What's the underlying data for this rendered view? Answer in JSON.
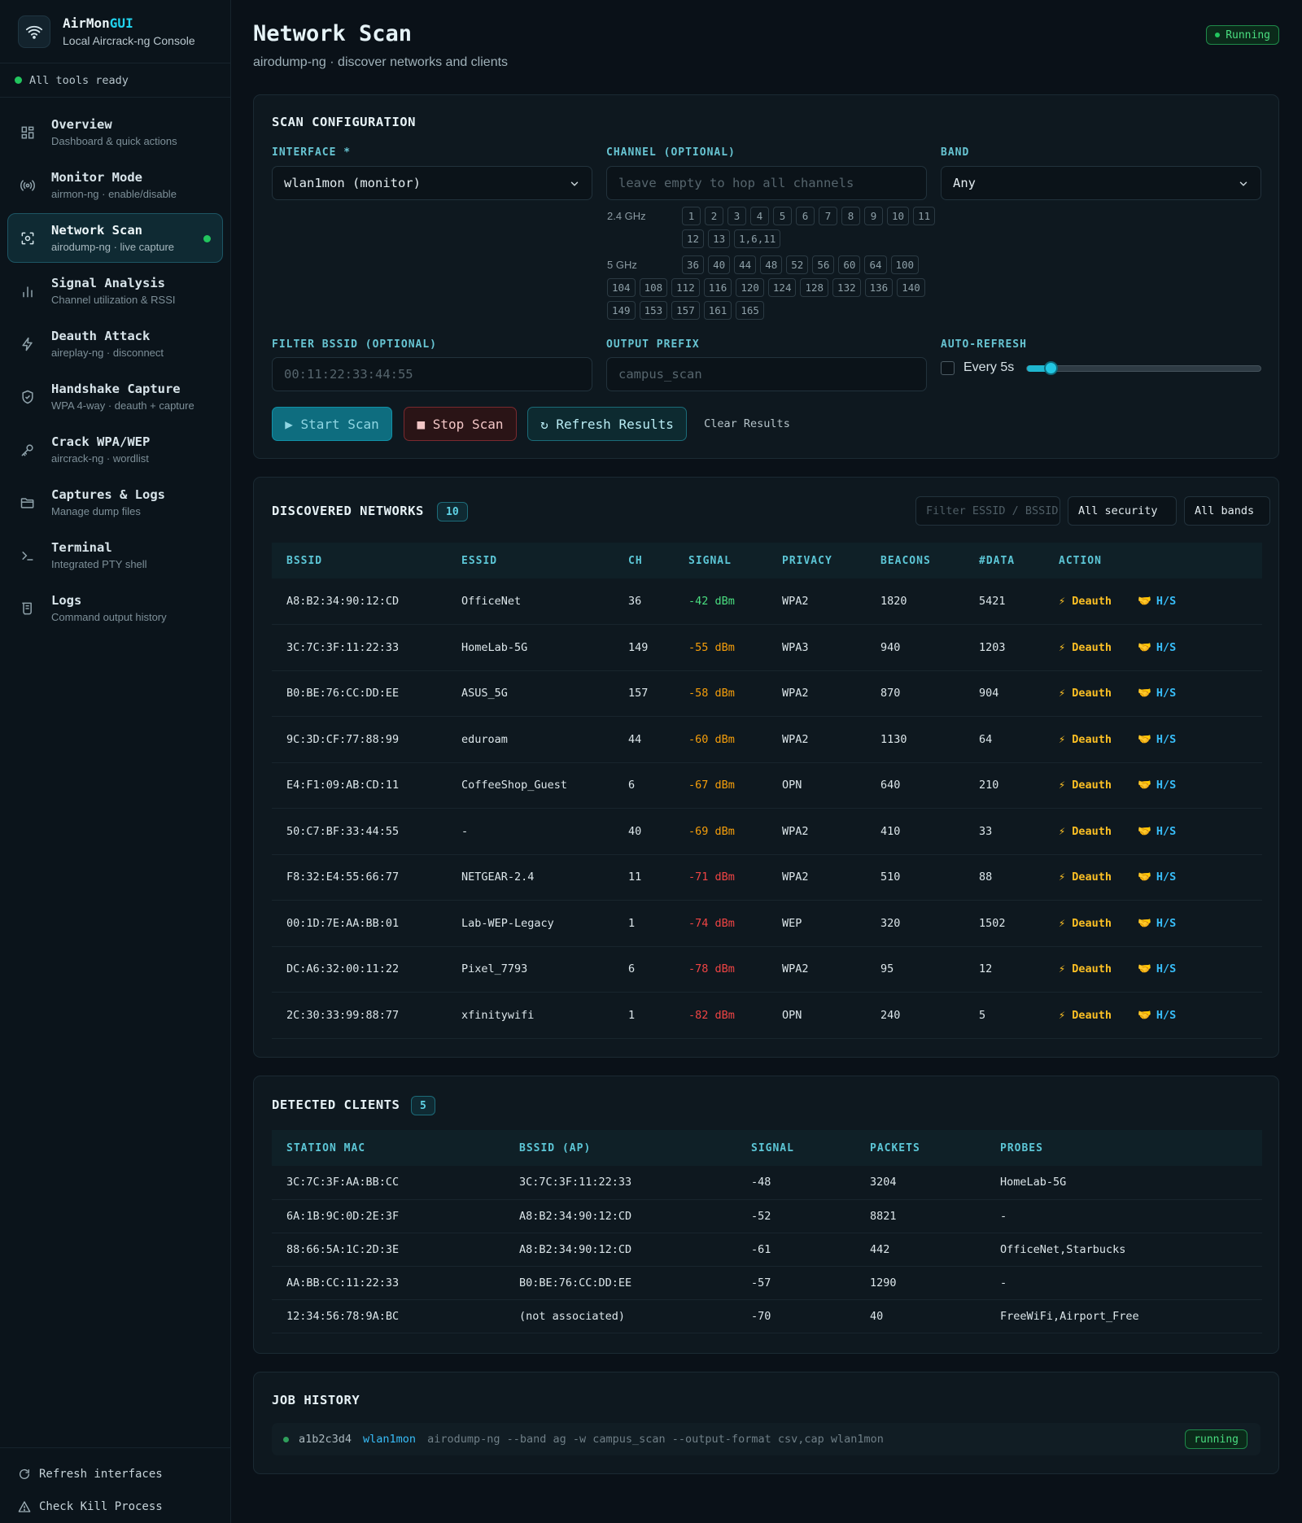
{
  "app": {
    "title_prefix": "AirMon",
    "title_accent": "GUI",
    "subtitle": "Local Aircrack-ng Console",
    "status": "All tools ready"
  },
  "sidebar": {
    "items": [
      {
        "label": "Overview",
        "sub": "Dashboard & quick actions",
        "icon": "grid-icon"
      },
      {
        "label": "Monitor Mode",
        "sub": "airmon-ng · enable/disable",
        "icon": "broadcast-icon"
      },
      {
        "label": "Network Scan",
        "sub": "airodump-ng · live capture",
        "icon": "scan-icon"
      },
      {
        "label": "Signal Analysis",
        "sub": "Channel utilization & RSSI",
        "icon": "bar-chart-icon"
      },
      {
        "label": "Deauth Attack",
        "sub": "aireplay-ng · disconnect",
        "icon": "bolt-icon"
      },
      {
        "label": "Handshake Capture",
        "sub": "WPA 4-way · deauth + capture",
        "icon": "shield-icon"
      },
      {
        "label": "Crack WPA/WEP",
        "sub": "aircrack-ng · wordlist",
        "icon": "key-icon"
      },
      {
        "label": "Captures & Logs",
        "sub": "Manage dump files",
        "icon": "folder-icon"
      },
      {
        "label": "Terminal",
        "sub": "Integrated PTY shell",
        "icon": "terminal-icon"
      },
      {
        "label": "Logs",
        "sub": "Command output history",
        "icon": "scroll-icon"
      }
    ],
    "refresh_interfaces": "Refresh interfaces",
    "check_kill": "Check Kill Process"
  },
  "header": {
    "title": "Network Scan",
    "subtitle": "airodump-ng · discover networks and clients",
    "status_badge": "Running"
  },
  "config": {
    "title": "SCAN CONFIGURATION",
    "interface_label": "INTERFACE *",
    "interface_value": "wlan1mon (monitor)",
    "channel_label": "CHANNEL (OPTIONAL)",
    "channel_placeholder": "leave empty to hop all channels",
    "band_label": "BAND",
    "band_value": "Any",
    "band_24_label": "2.4 GHz",
    "channels_24": [
      "1",
      "2",
      "3",
      "4",
      "5",
      "6",
      "7",
      "8",
      "9",
      "10",
      "11",
      "12",
      "13",
      "1,6,11"
    ],
    "band_5_label": "5 GHz",
    "channels_5": [
      "36",
      "40",
      "44",
      "48",
      "52",
      "56",
      "60",
      "64",
      "100",
      "104",
      "108",
      "112",
      "116",
      "120",
      "124",
      "128",
      "132",
      "136",
      "140",
      "149",
      "153",
      "157",
      "161",
      "165"
    ],
    "filter_bssid_label": "FILTER BSSID (OPTIONAL)",
    "filter_bssid_placeholder": "00:11:22:33:44:55",
    "output_prefix_label": "OUTPUT PREFIX",
    "output_prefix_placeholder": "campus_scan",
    "auto_refresh_label": "AUTO-REFRESH",
    "auto_refresh_text": "Every 5s",
    "auto_refresh_checked": false,
    "auto_refresh_level": 0.1,
    "start_label": "▶ Start Scan",
    "stop_label": "■ Stop Scan",
    "refresh_label": "↻ Refresh Results",
    "clear_label": "Clear Results"
  },
  "networks": {
    "title": "DISCOVERED NETWORKS",
    "count": "10",
    "filter_placeholder": "Filter ESSID / BSSID",
    "security_select": "All security",
    "bands_select": "All bands",
    "columns": [
      "BSSID",
      "ESSID",
      "CH",
      "SIGNAL",
      "PRIVACY",
      "BEACONS",
      "#DATA",
      "ACTION"
    ],
    "deauth_label": "⚡ Deauth",
    "hs_label": "H/S",
    "rows": [
      {
        "bssid": "A8:B2:34:90:12:CD",
        "essid": "OfficeNet",
        "ch": "36",
        "signal": "-42 dBm",
        "privacy": "WPA2",
        "beacons": "1820",
        "data": "5421",
        "quality": "good"
      },
      {
        "bssid": "3C:7C:3F:11:22:33",
        "essid": "HomeLab-5G",
        "ch": "149",
        "signal": "-55 dBm",
        "privacy": "WPA3",
        "beacons": "940",
        "data": "1203",
        "quality": "mid"
      },
      {
        "bssid": "B0:BE:76:CC:DD:EE",
        "essid": "ASUS_5G",
        "ch": "157",
        "signal": "-58 dBm",
        "privacy": "WPA2",
        "beacons": "870",
        "data": "904",
        "quality": "mid"
      },
      {
        "bssid": "9C:3D:CF:77:88:99",
        "essid": "eduroam",
        "ch": "44",
        "signal": "-60 dBm",
        "privacy": "WPA2",
        "beacons": "1130",
        "data": "64",
        "quality": "mid"
      },
      {
        "bssid": "E4:F1:09:AB:CD:11",
        "essid": "CoffeeShop_Guest",
        "ch": "6",
        "signal": "-67 dBm",
        "privacy": "OPN",
        "beacons": "640",
        "data": "210",
        "quality": "mid"
      },
      {
        "bssid": "50:C7:BF:33:44:55",
        "essid": "-",
        "ch": "40",
        "signal": "-69 dBm",
        "privacy": "WPA2",
        "beacons": "410",
        "data": "33",
        "quality": "mid"
      },
      {
        "bssid": "F8:32:E4:55:66:77",
        "essid": "NETGEAR-2.4",
        "ch": "11",
        "signal": "-71 dBm",
        "privacy": "WPA2",
        "beacons": "510",
        "data": "88",
        "quality": "bad"
      },
      {
        "bssid": "00:1D:7E:AA:BB:01",
        "essid": "Lab-WEP-Legacy",
        "ch": "1",
        "signal": "-74 dBm",
        "privacy": "WEP",
        "beacons": "320",
        "data": "1502",
        "quality": "bad"
      },
      {
        "bssid": "DC:A6:32:00:11:22",
        "essid": "Pixel_7793",
        "ch": "6",
        "signal": "-78 dBm",
        "privacy": "WPA2",
        "beacons": "95",
        "data": "12",
        "quality": "bad"
      },
      {
        "bssid": "2C:30:33:99:88:77",
        "essid": "xfinitywifi",
        "ch": "1",
        "signal": "-82 dBm",
        "privacy": "OPN",
        "beacons": "240",
        "data": "5",
        "quality": "bad"
      }
    ]
  },
  "clients": {
    "title": "DETECTED CLIENTS",
    "count": "5",
    "columns": [
      "STATION MAC",
      "BSSID (AP)",
      "SIGNAL",
      "PACKETS",
      "PROBES"
    ],
    "rows": [
      {
        "station": "3C:7C:3F:AA:BB:CC",
        "bssid": "3C:7C:3F:11:22:33",
        "signal": "-48",
        "packets": "3204",
        "probes": "HomeLab-5G"
      },
      {
        "station": "6A:1B:9C:0D:2E:3F",
        "bssid": "A8:B2:34:90:12:CD",
        "signal": "-52",
        "packets": "8821",
        "probes": "-"
      },
      {
        "station": "88:66:5A:1C:2D:3E",
        "bssid": "A8:B2:34:90:12:CD",
        "signal": "-61",
        "packets": "442",
        "probes": "OfficeNet,Starbucks"
      },
      {
        "station": "AA:BB:CC:11:22:33",
        "bssid": "B0:BE:76:CC:DD:EE",
        "signal": "-57",
        "packets": "1290",
        "probes": "-"
      },
      {
        "station": "12:34:56:78:9A:BC",
        "bssid": "(not associated)",
        "signal": "-70",
        "packets": "40",
        "probes": "FreeWiFi,Airport_Free"
      }
    ]
  },
  "jobs": {
    "title": "JOB HISTORY",
    "items": [
      {
        "id": "a1b2c3d4",
        "iface": "wlan1mon",
        "cmd": "airodump-ng --band ag -w campus_scan --output-format csv,cap wlan1mon",
        "status": "running"
      }
    ]
  },
  "colors": {
    "accent": "#22d3ee",
    "good": "#4ade80",
    "mid": "#f59e0b",
    "bad": "#ef4444",
    "warn": "#fbbf24"
  }
}
